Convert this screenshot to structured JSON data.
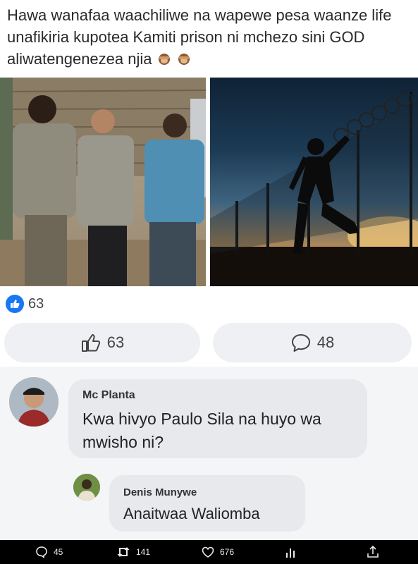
{
  "post": {
    "text": "Hawa wanafaa waachiliwe na wapewe pesa waanze life unafikiria kupotea Kamiti prison ni mchezo sini GOD aliwatengenezea njia",
    "emoji_icons": [
      "see-no-evil-monkey-icon",
      "see-no-evil-monkey-icon"
    ]
  },
  "reactions": {
    "count": "63"
  },
  "actions": {
    "like_count": "63",
    "comment_count": "48"
  },
  "comments": [
    {
      "author": "Mc Planta",
      "text": "Kwa hivyo Paulo Sila na huyo wa mwisho ni?"
    },
    {
      "author": "Denis Munywe",
      "text": "Anaitwaa Waliomba"
    }
  ],
  "twitter_bar": {
    "replies": "45",
    "retweets": "141",
    "likes": "676"
  },
  "colors": {
    "facebook_blue": "#1877f2",
    "bubble_gray": "#e7e9ed",
    "bar_black": "#000000"
  }
}
